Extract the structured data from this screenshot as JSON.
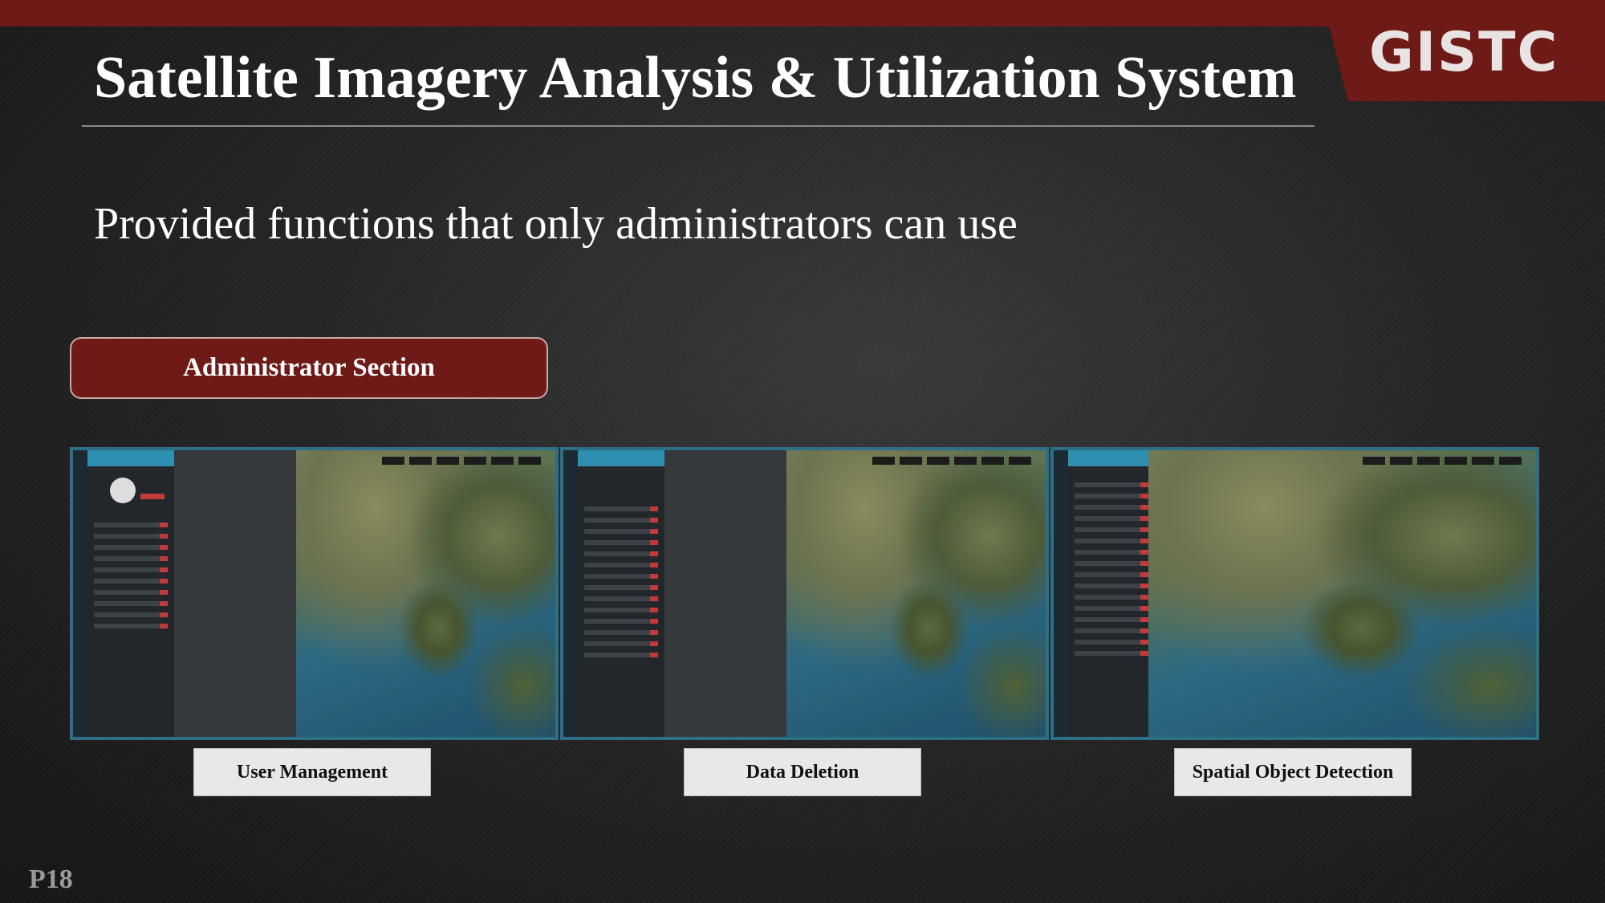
{
  "header": {
    "title": "Satellite Imagery Analysis & Utilization System",
    "logo_text": "GISTC"
  },
  "subtitle": "Provided functions that only administrators can use",
  "section": {
    "button_label": "Administrator Section"
  },
  "screenshots": [
    {
      "caption": "User Management"
    },
    {
      "caption": "Data Deletion"
    },
    {
      "caption": "Spatial Object Detection"
    }
  ],
  "footer": {
    "page_number": "P18"
  },
  "colors": {
    "brand_red": "#6e1a17",
    "frame_teal": "#2c6f86",
    "caption_bg": "#e8e8e8"
  }
}
